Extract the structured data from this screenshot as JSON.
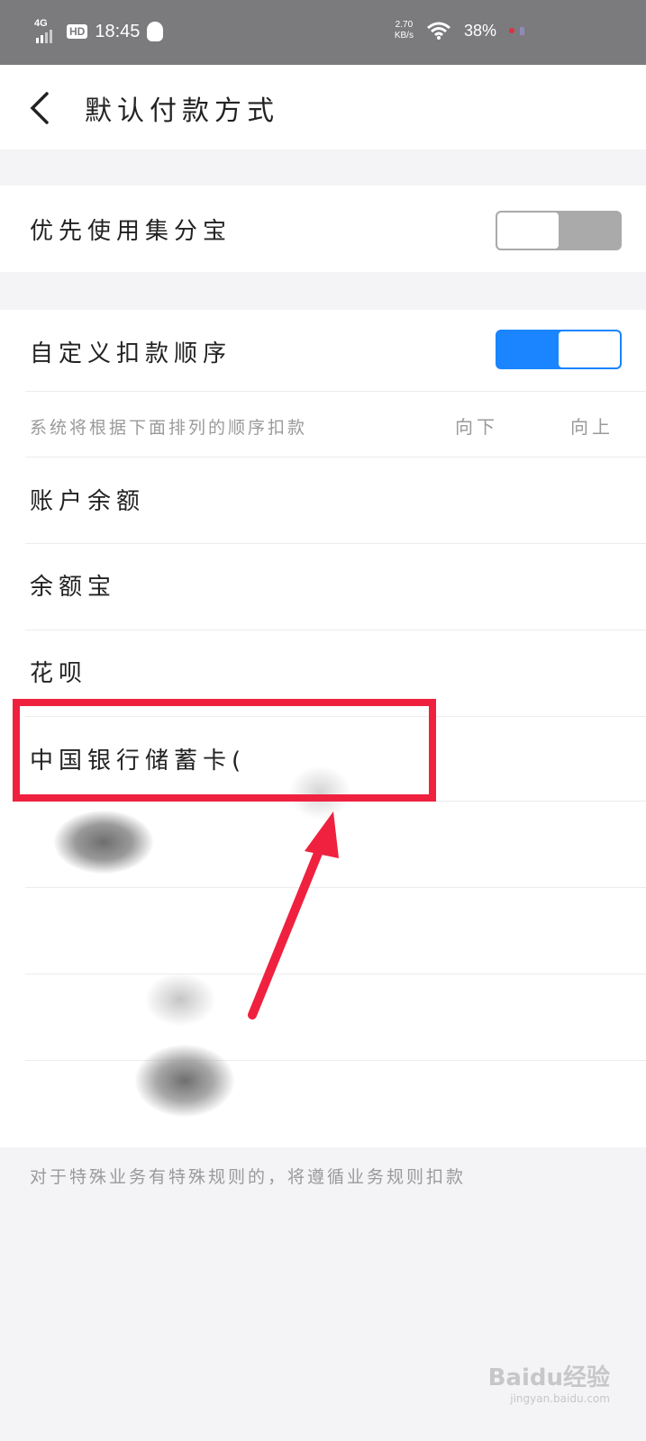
{
  "status_bar": {
    "network": "4G",
    "hd_badge": "HD",
    "time": "18:45",
    "speed_value": "2.70",
    "speed_unit": "KB/s",
    "battery": "38%"
  },
  "header": {
    "title": "默认付款方式"
  },
  "settings": {
    "prefer_jifenbao_label": "优先使用集分宝",
    "prefer_jifenbao_on": false,
    "custom_order_label": "自定义扣款顺序",
    "custom_order_on": true,
    "order_hint": "系统将根据下面排列的顺序扣款",
    "move_down": "向下",
    "move_up": "向上"
  },
  "payment_methods": [
    {
      "label": "账户余额"
    },
    {
      "label": "余额宝"
    },
    {
      "label": "花呗"
    },
    {
      "label": "中国银行储蓄卡("
    }
  ],
  "footer_note": "对于特殊业务有特殊规则的，将遵循业务规则扣款",
  "colors": {
    "toggle_on": "#1a85ff",
    "highlight": "#f0213f",
    "status_bar": "#7b7a7d"
  },
  "watermark": {
    "text": "Baidu经验",
    "sub": "jingyan.baidu.com"
  }
}
